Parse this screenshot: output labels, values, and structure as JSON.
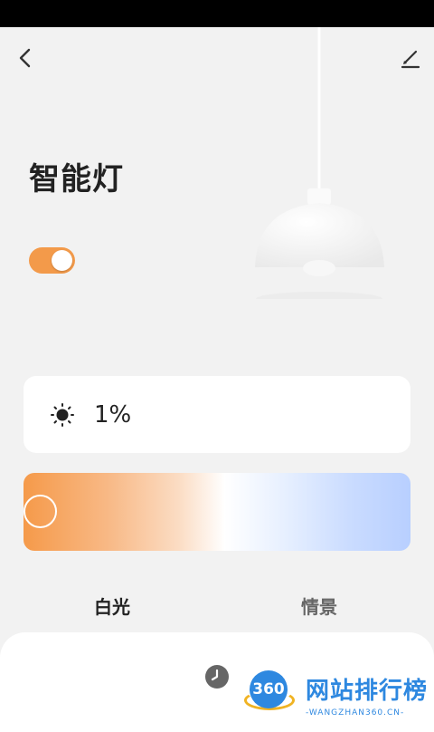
{
  "page": {
    "title": "智能灯",
    "power_on": true
  },
  "brightness": {
    "value": "1%",
    "icon": "sun-icon"
  },
  "color_temperature": {
    "position": 0.0
  },
  "tabs": [
    {
      "label": "白光",
      "active": true
    },
    {
      "label": "情景",
      "active": false
    }
  ],
  "watermark": {
    "badge": "360",
    "text": "网站排行榜",
    "sub": "-WANGZHAN360.CN-"
  },
  "colors": {
    "accent": "#f39a4a",
    "background": "#f2f2f2",
    "warm_end": "#f59a4a",
    "cool_end": "#b8cfff"
  }
}
